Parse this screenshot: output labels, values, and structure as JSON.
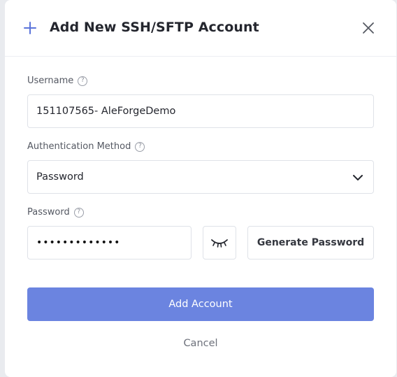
{
  "dialog": {
    "title": "Add New SSH/SFTP Account",
    "accent_color": "#5b74da",
    "primary_color": "#6b84e0"
  },
  "form": {
    "username": {
      "label": "Username",
      "value": "151107565- AleForgeDemo"
    },
    "auth_method": {
      "label": "Authentication Method",
      "selected": "Password"
    },
    "password": {
      "label": "Password",
      "masked_value": "•••••••••••••"
    },
    "help_glyph": "?"
  },
  "actions": {
    "generate_label": "Generate Password",
    "submit_label": "Add Account",
    "cancel_label": "Cancel"
  }
}
